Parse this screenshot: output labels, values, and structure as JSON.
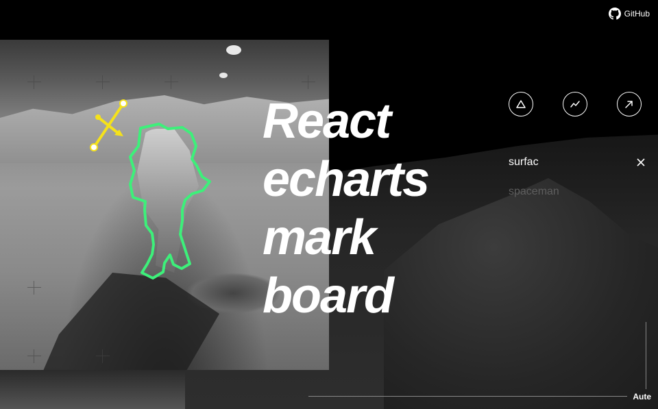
{
  "header": {
    "github_label": "GitHub",
    "github_icon": "github-icon"
  },
  "title": {
    "lines": [
      "React",
      "echarts",
      "mark",
      "board"
    ]
  },
  "tools": [
    {
      "icon": "triangle-icon",
      "name": "polygon-tool"
    },
    {
      "icon": "line-chart-icon",
      "name": "polyline-tool"
    },
    {
      "icon": "arrow-up-right-icon",
      "name": "arrow-tool"
    }
  ],
  "labels": {
    "items": [
      {
        "text": "surfac",
        "active": true
      },
      {
        "text": "spaceman",
        "active": false
      }
    ]
  },
  "footer": {
    "mode_label": "Aute"
  },
  "colors": {
    "annotation_green": "#3df07a",
    "annotation_yellow": "#f5e21b",
    "inactive_label": "#5e5e5e"
  }
}
